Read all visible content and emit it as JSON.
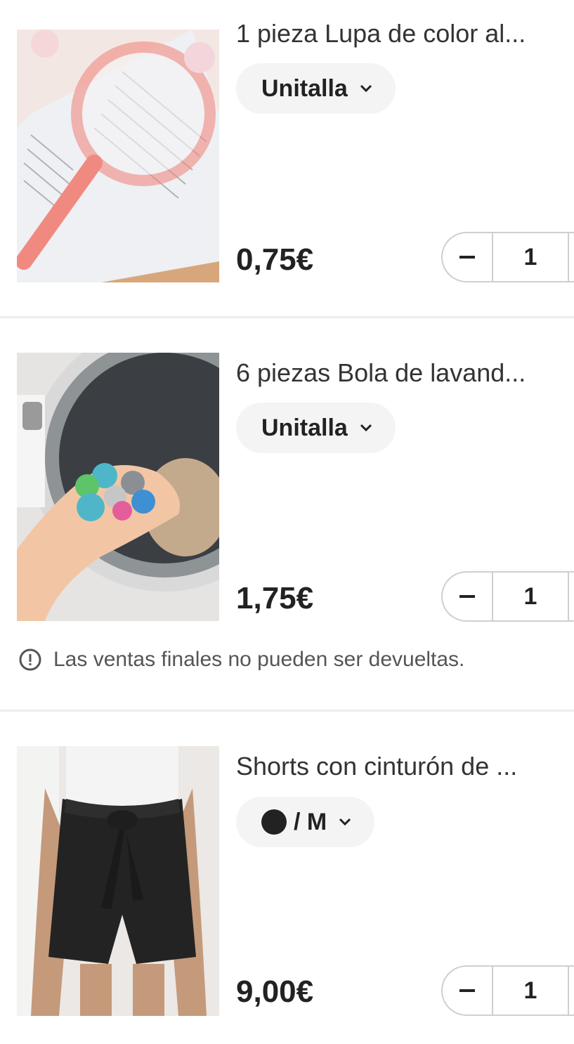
{
  "items": [
    {
      "title": "1 pieza Lupa de color al...",
      "variant_label": "Unitalla",
      "price": "0,75€",
      "quantity": "1",
      "image_icon": "magnifying-glass-photo"
    },
    {
      "title": "6 piezas Bola de lavand...",
      "variant_label": "Unitalla",
      "price": "1,75€",
      "quantity": "1",
      "image_icon": "laundry-balls-photo"
    },
    {
      "title": "Shorts con cinturón de ...",
      "variant_label": "/ M",
      "variant_color": "#222222",
      "price": "9,00€",
      "quantity": "1",
      "image_icon": "black-shorts-photo"
    }
  ],
  "notice": {
    "text": "Las ventas finales no pueden ser devueltas.",
    "icon": "exclamation-circle-icon"
  },
  "colors": {
    "divider": "#ececec",
    "pill_bg": "#f4f4f4",
    "text": "#222222"
  }
}
